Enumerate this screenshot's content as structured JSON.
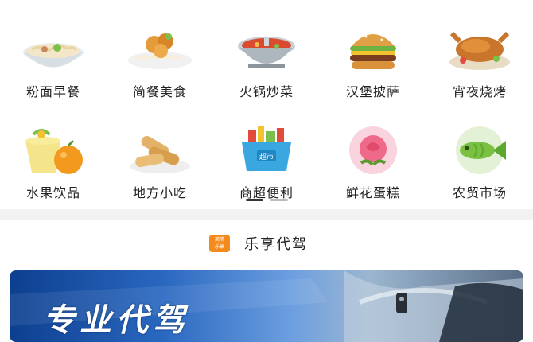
{
  "categories": [
    {
      "label": "粉面早餐",
      "icon": "noodle-bowl-icon"
    },
    {
      "label": "简餐美食",
      "icon": "fried-chicken-plate-icon"
    },
    {
      "label": "火锅炒菜",
      "icon": "hot-pot-icon"
    },
    {
      "label": "汉堡披萨",
      "icon": "burger-icon"
    },
    {
      "label": "宵夜烧烤",
      "icon": "roast-chicken-icon"
    },
    {
      "label": "水果饮品",
      "icon": "juice-fruit-icon"
    },
    {
      "label": "地方小吃",
      "icon": "spring-roll-icon"
    },
    {
      "label": "商超便利",
      "icon": "supermarket-basket-icon"
    },
    {
      "label": "鲜花蛋糕",
      "icon": "rose-cake-icon"
    },
    {
      "label": "农贸市场",
      "icon": "fish-icon"
    }
  ],
  "pager": {
    "active_index": 0,
    "count": 2
  },
  "section": {
    "title": "乐享代驾",
    "logo_text_top": "简简",
    "logo_text_bottom": "乐享"
  },
  "banner": {
    "text": "专业代驾"
  },
  "colors": {
    "accent": "#f28a1c",
    "banner_blue": "#2a68c0"
  }
}
